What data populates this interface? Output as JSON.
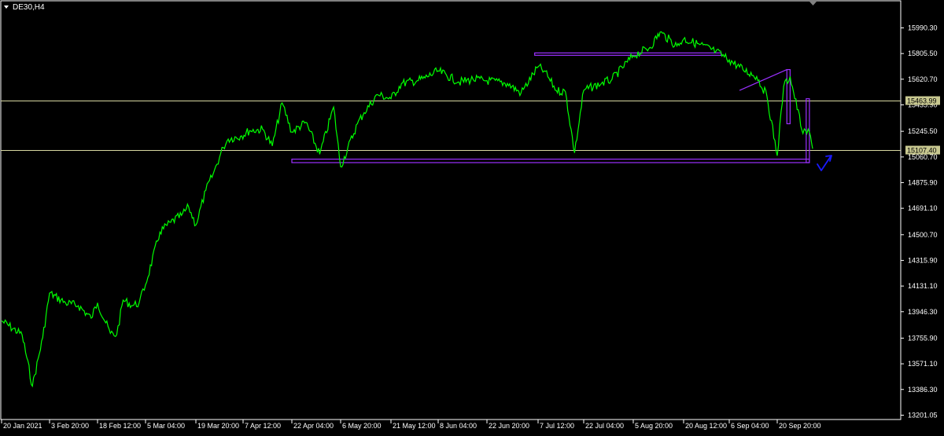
{
  "window": {
    "title": "DE30,H4",
    "menu_icon": "triangle-down-icon",
    "scroll_marker_icon": "triangle-down-icon"
  },
  "colors": {
    "background": "#000000",
    "price_line": "#00ff00",
    "axis": "#ffffff",
    "horizontal_line": "#d8d8a0",
    "label_fill": "#c8c890",
    "drawing": "#9b30ff",
    "arrow": "#1a1aff"
  },
  "chart_data": {
    "type": "line",
    "symbol": "DE30",
    "timeframe": "H4",
    "title": "DE30,H4",
    "xlabel": "",
    "ylabel": "",
    "grid": false,
    "legend": "none",
    "ylim": [
      13201.05,
      16100
    ],
    "y_ticks": [
      "15990.30",
      "15805.50",
      "15620.70",
      "15435.90",
      "15245.50",
      "15060.70",
      "14875.90",
      "14691.10",
      "14500.70",
      "14315.90",
      "14131.10",
      "13946.30",
      "13755.90",
      "13571.10",
      "13386.30",
      "13201.05"
    ],
    "x_ticks": [
      "20 Jan 2021",
      "3 Feb 20:00",
      "18 Feb 12:00",
      "5 Mar 04:00",
      "19 Mar 20:00",
      "7 Apr 12:00",
      "22 Apr 04:00",
      "6 May 20:00",
      "21 May 12:00",
      "8 Jun 04:00",
      "22 Jun 20:00",
      "7 Jul 12:00",
      "22 Jul 04:00",
      "5 Aug 20:00",
      "20 Aug 12:00",
      "6 Sep 04:00",
      "20 Sep 20:00"
    ],
    "series": [
      {
        "x": [
          "20 Jan",
          "26 Jan",
          "29 Jan",
          "1 Feb",
          "3 Feb",
          "8 Feb",
          "12 Feb",
          "16 Feb",
          "18 Feb",
          "22 Feb",
          "24 Feb",
          "26 Feb",
          "1 Mar",
          "3 Mar",
          "5 Mar",
          "9 Mar",
          "12 Mar",
          "15 Mar",
          "17 Mar",
          "19 Mar",
          "23 Mar",
          "26 Mar",
          "30 Mar",
          "1 Apr",
          "6 Apr",
          "9 Apr",
          "13 Apr",
          "16 Apr",
          "19 Apr",
          "22 Apr",
          "26 Apr",
          "30 Apr",
          "4 May",
          "6 May",
          "11 May",
          "13 May",
          "17 May",
          "21 May",
          "25 May",
          "31 May",
          "3 Jun",
          "8 Jun",
          "14 Jun",
          "18 Jun",
          "22 Jun",
          "28 Jun",
          "2 Jul",
          "7 Jul",
          "9 Jul",
          "13 Jul",
          "16 Jul",
          "19 Jul",
          "22 Jul",
          "27 Jul",
          "30 Jul",
          "5 Aug",
          "10 Aug",
          "13 Aug",
          "18 Aug",
          "20 Aug",
          "26 Aug",
          "1 Sep",
          "6 Sep",
          "10 Sep",
          "14 Sep",
          "17 Sep",
          "20 Sep",
          "22 Sep",
          "24 Sep",
          "28 Sep",
          "30 Sep",
          "1 Oct"
        ],
        "values": [
          13880,
          13780,
          13410,
          13760,
          14080,
          14010,
          13990,
          13900,
          14010,
          13790,
          13780,
          14030,
          13990,
          14010,
          14140,
          14520,
          14590,
          14640,
          14700,
          14570,
          14820,
          14940,
          15130,
          15190,
          15210,
          15250,
          15260,
          15140,
          15450,
          15240,
          15310,
          15080,
          15420,
          14990,
          15300,
          15380,
          15510,
          15480,
          15590,
          15610,
          15630,
          15680,
          15600,
          15620,
          15610,
          15590,
          15520,
          15710,
          15680,
          15540,
          15530,
          15090,
          15540,
          15590,
          15620,
          15790,
          15850,
          15960,
          15860,
          15910,
          15870,
          15820,
          15760,
          15690,
          15640,
          15500,
          15070,
          15570,
          15640,
          15230,
          15240,
          15120
        ]
      }
    ],
    "horizontal_lines": [
      {
        "price": 15463.99,
        "label": "15463.99"
      },
      {
        "price": 15107.4,
        "label": "15107.40"
      }
    ],
    "drawings": [
      {
        "kind": "rectangle",
        "from": "22 Apr",
        "to": "30 Sep",
        "low": 15020,
        "high": 15045
      },
      {
        "kind": "rectangle",
        "from": "6 Jul",
        "to": "3 Sep",
        "low": 15800,
        "high": 15810
      },
      {
        "kind": "trendline",
        "from": "9 Sep",
        "to": "23 Sep",
        "start": 15540,
        "end": 15690
      },
      {
        "kind": "rectangle",
        "from": "23 Sep",
        "to": "24 Sep",
        "low": 15300,
        "high": 15690
      },
      {
        "kind": "rectangle",
        "from": "29 Sep",
        "to": "30 Sep",
        "low": 15020,
        "high": 15480
      }
    ]
  }
}
